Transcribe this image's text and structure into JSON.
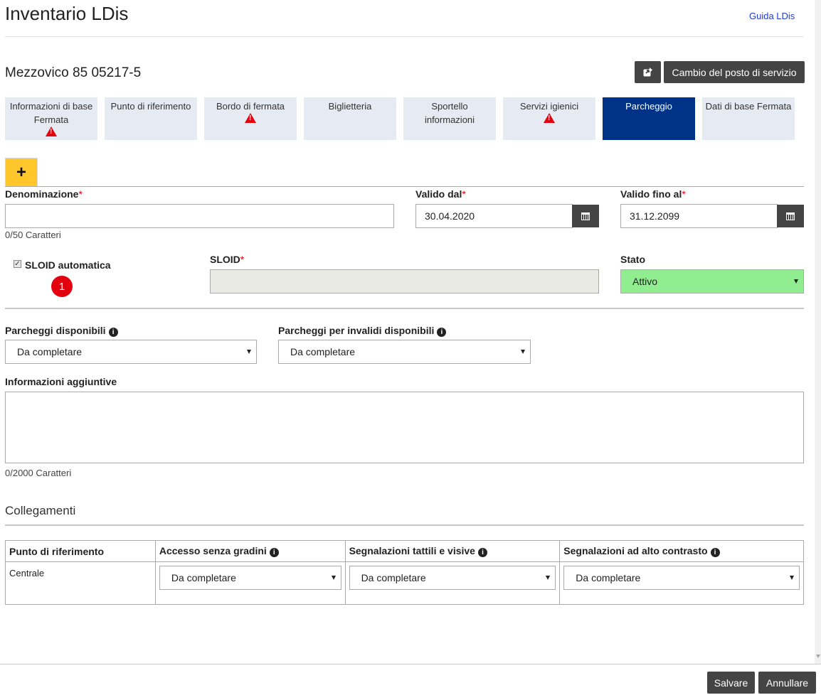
{
  "header": {
    "title": "Inventario LDis",
    "help_link": "Guida LDis"
  },
  "stop": {
    "name": "Mezzovico 85 05217-5",
    "change_button": "Cambio del posto di servizio",
    "export_icon": "share-icon"
  },
  "tabs": [
    {
      "label": "Informazioni di base Fermata",
      "warning": true
    },
    {
      "label": "Punto di riferimento",
      "warning": false
    },
    {
      "label": "Bordo di fermata",
      "warning": true
    },
    {
      "label": "Biglietteria",
      "warning": false
    },
    {
      "label": "Sportello informazioni",
      "warning": false
    },
    {
      "label": "Servizi igienici",
      "warning": true
    },
    {
      "label": "Parcheggio",
      "warning": false,
      "active": true
    },
    {
      "label": "Dati di base Fermata",
      "warning": false
    }
  ],
  "add_tab": {
    "label": "+"
  },
  "form": {
    "denominazione": {
      "label": "Denominazione",
      "value": "",
      "counter": "0/50 Caratteri"
    },
    "valido_dal": {
      "label": "Valido dal",
      "value": "30.04.2020"
    },
    "valido_fino": {
      "label": "Valido fino al",
      "value": "31.12.2099"
    },
    "sloid_auto": {
      "label": "SLOID automatica",
      "checked": true,
      "badge": "1"
    },
    "sloid": {
      "label": "SLOID",
      "value": ""
    },
    "stato": {
      "label": "Stato",
      "value": "Attivo"
    },
    "parcheggi": {
      "label": "Parcheggi disponibili",
      "value": "Da completare"
    },
    "parcheggi_invalidi": {
      "label": "Parcheggi per invalidi disponibili",
      "value": "Da completare"
    },
    "info": {
      "label": "Informazioni aggiuntive",
      "value": "",
      "counter": "0/2000 Caratteri"
    }
  },
  "collegamenti": {
    "title": "Collegamenti",
    "columns": [
      "Punto di riferimento",
      "Accesso senza gradini",
      "Segnalazioni tattili e visive",
      "Segnalazioni ad alto contrasto"
    ],
    "rows": [
      {
        "punto": "Centrale",
        "accesso": "Da completare",
        "tattili": "Da completare",
        "contrasto": "Da completare"
      }
    ]
  },
  "footer": {
    "save": "Salvare",
    "cancel": "Annullare"
  },
  "colors": {
    "active_tab": "#003388",
    "tab_bg": "#e6eaf2",
    "add_tab": "#ffc72c",
    "stato_bg": "#90ee90",
    "warning": "#e3000f"
  }
}
